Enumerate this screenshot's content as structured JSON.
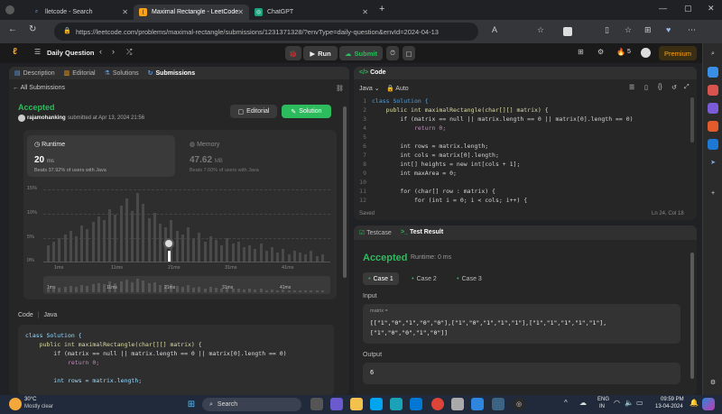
{
  "browser": {
    "tabs": [
      {
        "label": "lletcode - Search",
        "active": false
      },
      {
        "label": "Maximal Rectangle - LeetCode",
        "active": true
      },
      {
        "label": "ChatGPT",
        "active": false
      }
    ],
    "url": "https://leetcode.com/problems/maximal-rectangle/submissions/1231371328/?envType=daily-question&envId=2024-04-13",
    "window_controls": [
      "—",
      "▢",
      "✕"
    ]
  },
  "lc_header": {
    "daily_question": "Daily Question",
    "run": "Run",
    "submit": "Submit",
    "streak": "5",
    "premium": "Premium"
  },
  "left": {
    "tabs": [
      "Description",
      "Editorial",
      "Solutions",
      "Submissions"
    ],
    "all_submissions": "All Submissions",
    "status": "Accepted",
    "user": "rajamohanking",
    "submitted": "submitted at Apr 13, 2024 21:56",
    "editorial_btn": "Editorial",
    "solution_btn": "Solution",
    "runtime": {
      "label": "Runtime",
      "value": "20",
      "unit": "ms",
      "beats": "Beats 37.92% of users with Java"
    },
    "memory": {
      "label": "Memory",
      "value": "47.62",
      "unit": "MB",
      "beats": "Beats 7.60% of users with Java"
    },
    "chart": {
      "y_ticks": [
        "15%",
        "10%",
        "5%",
        "0%"
      ],
      "x_ticks": [
        "1ms",
        "11ms",
        "21ms",
        "31ms",
        "41ms"
      ],
      "mini_x_ticks": [
        "1ms",
        "11ms",
        "21ms",
        "31ms",
        "41ms"
      ]
    },
    "code_header": {
      "code": "Code",
      "lang": "Java"
    },
    "code_preview": [
      "class Solution {",
      "    public int maximalRectangle(char[][] matrix) {",
      "        if (matrix == null || matrix.length == 0 || matrix[0].length == 0)",
      "            return 0;",
      "",
      "        int rows = matrix.length;"
    ]
  },
  "editor": {
    "title": "Code",
    "lang": "Java",
    "mode": "Auto",
    "saved": "Saved",
    "position": "Ln 24, Col 18",
    "lines": [
      {
        "n": "1",
        "t": "class Solution {"
      },
      {
        "n": "2",
        "t": "    public int maximalRectangle(char[][] matrix) {"
      },
      {
        "n": "3",
        "t": "        if (matrix == null || matrix.length == 0 || matrix[0].length == 0)"
      },
      {
        "n": "4",
        "t": "            return 0;"
      },
      {
        "n": "5",
        "t": ""
      },
      {
        "n": "6",
        "t": "        int rows = matrix.length;"
      },
      {
        "n": "7",
        "t": "        int cols = matrix[0].length;"
      },
      {
        "n": "8",
        "t": "        int[] heights = new int[cols + 1];"
      },
      {
        "n": "9",
        "t": "        int maxArea = 0;"
      },
      {
        "n": "10",
        "t": ""
      },
      {
        "n": "11",
        "t": "        for (char[] row : matrix) {"
      },
      {
        "n": "12",
        "t": "            for (int i = 0; i < cols; i++) {"
      }
    ]
  },
  "test": {
    "tab_testcase": "Testcase",
    "tab_result": "Test Result",
    "status": "Accepted",
    "runtime": "Runtime: 0 ms",
    "cases": [
      "Case 1",
      "Case 2",
      "Case 3"
    ],
    "input_label": "Input",
    "var_name": "matrix =",
    "value_line1": "[[\"1\",\"0\",\"1\",\"0\",\"0\"],[\"1\",\"0\",\"1\",\"1\",\"1\"],[\"1\",\"1\",\"1\",\"1\",\"1\"],",
    "value_line2": "[\"1\",\"0\",\"0\",\"1\",\"0\"]]",
    "output_label": "Output",
    "output_value": "6"
  },
  "taskbar": {
    "weather_temp": "30°C",
    "weather_desc": "Mostly clear",
    "search": "Search",
    "lang1": "ENG",
    "lang2": "IN",
    "time": "09:59 PM",
    "date": "13-04-2024"
  }
}
